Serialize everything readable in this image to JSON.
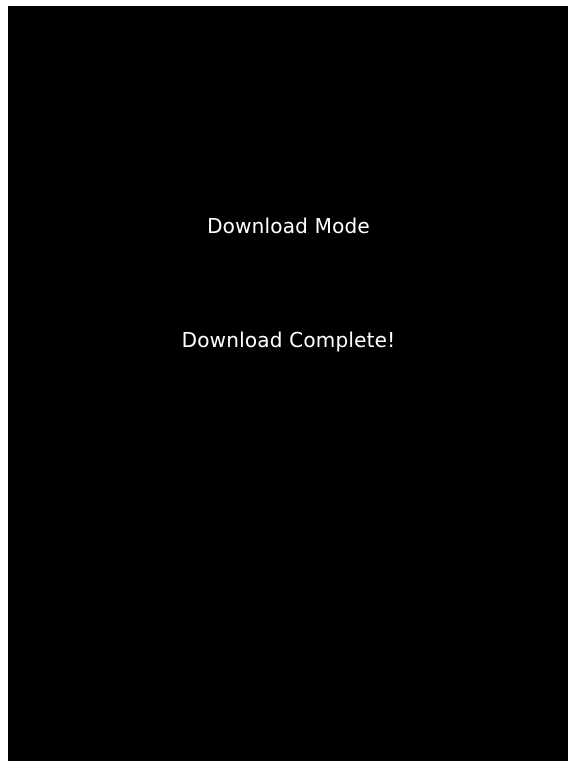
{
  "screen": {
    "title": "Download Mode",
    "status": "Download Complete!",
    "colors": {
      "background": "#000000",
      "text": "#ffffff",
      "border": "#ffffff"
    }
  }
}
